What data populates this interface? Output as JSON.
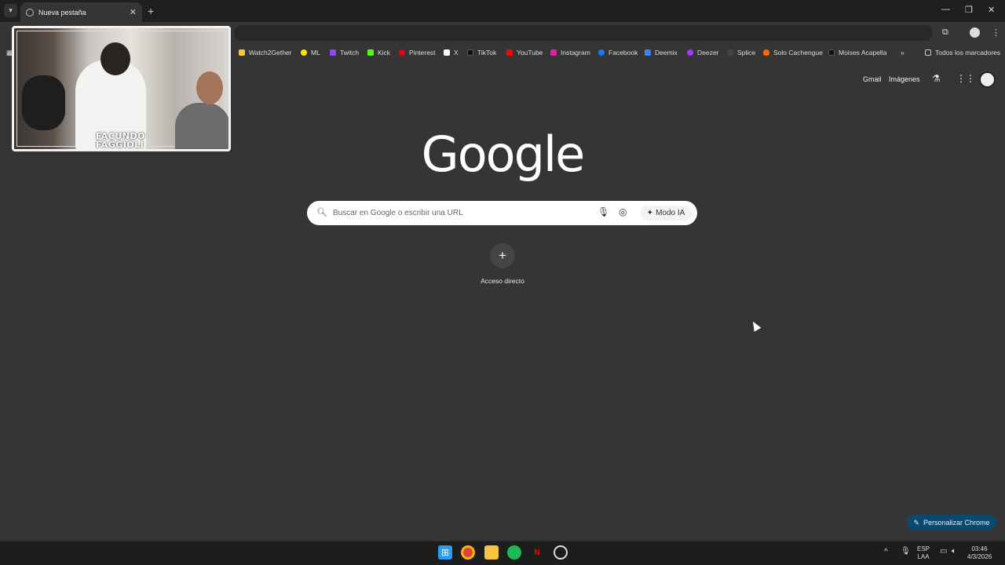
{
  "browser": {
    "tab_title": "Nueva pestaña",
    "tab_close": "✕",
    "new_tab": "+",
    "window_controls": {
      "minimize": "—",
      "restore": "❐",
      "close": "✕"
    }
  },
  "bookmarks": {
    "items": [
      {
        "label": "Watch2Gether",
        "color": "#f4c542"
      },
      {
        "label": "ML",
        "color": "#ffe600"
      },
      {
        "label": "Twitch",
        "color": "#9146ff"
      },
      {
        "label": "Kick",
        "color": "#53fc18"
      },
      {
        "label": "Pinterest",
        "color": "#e60023"
      },
      {
        "label": "X",
        "color": "#ffffff"
      },
      {
        "label": "TikTok",
        "color": "#111111"
      },
      {
        "label": "YouTube",
        "color": "#ff0000"
      },
      {
        "label": "Instagram",
        "color": "#d6249f"
      },
      {
        "label": "Facebook",
        "color": "#1877f2"
      },
      {
        "label": "Deemix",
        "color": "#3b82f6"
      },
      {
        "label": "Deezer",
        "color": "#a238ff"
      },
      {
        "label": "Splice",
        "color": "#444444"
      },
      {
        "label": "Solo Cachengue",
        "color": "#ff6a00"
      },
      {
        "label": "Moises Acapella",
        "color": "#111111"
      }
    ],
    "more": "»",
    "all_bookmarks": "Todos los marcadores"
  },
  "webcam": {
    "label_line1": "FACUNDO",
    "label_line2": "FAGGIOLI"
  },
  "google": {
    "links": {
      "gmail": "Gmail",
      "images": "Imágenes"
    },
    "logo": "Google",
    "search_placeholder": "Buscar en Google o escribir una URL",
    "ai_mode": "Modo IA",
    "shortcut_plus": "+",
    "shortcut_label": "Acceso directo",
    "customize": "Personalizar Chrome"
  },
  "taskbar": {
    "language_line1": "ESP",
    "language_line2": "LAA",
    "time": "03:46",
    "date": "4/3/2026",
    "tray_arrow": "^"
  }
}
